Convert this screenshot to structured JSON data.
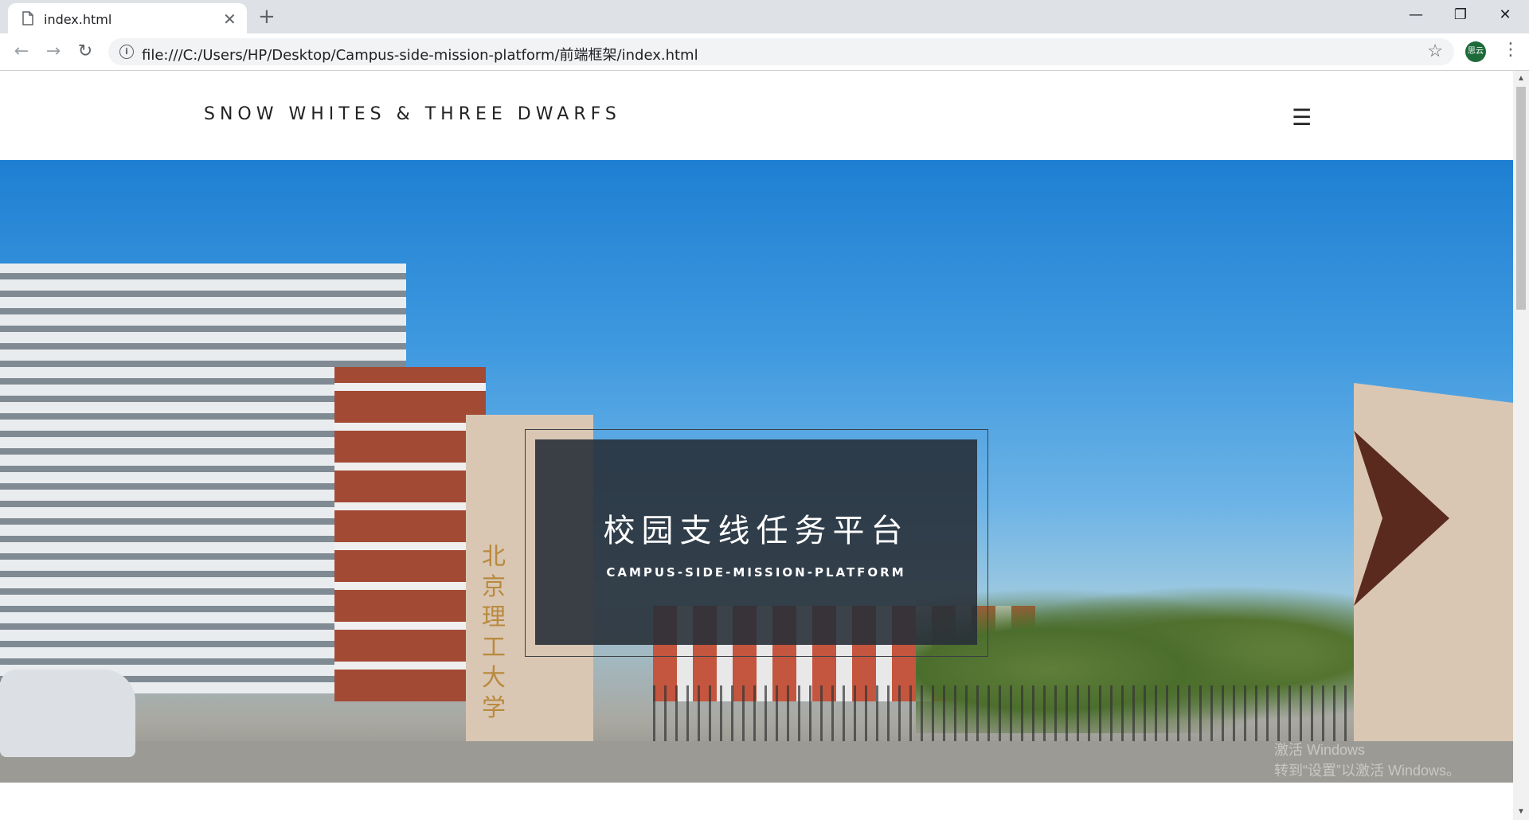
{
  "browser": {
    "tab_title": "index.html",
    "tab_close": "✕",
    "new_tab": "+",
    "window_controls": {
      "minimize": "—",
      "restore": "❐",
      "close": "✕"
    },
    "nav": {
      "back": "←",
      "forward": "→",
      "reload": "↻"
    },
    "url": "file:///C:/Users/HP/Desktop/Campus-side-mission-platform/前端框架/index.html",
    "info_icon": "i",
    "star": "☆",
    "profile_label": "思云",
    "menu": "⋮"
  },
  "site": {
    "brand": "SNOW WHITES & THREE DWARFS",
    "menu_icon": "☰"
  },
  "hero": {
    "title": "校园支线任务平台",
    "subtitle": "CAMPUS-SIDE-MISSION-PLATFORM",
    "gate_sign": "北京理工大学"
  },
  "watermark": {
    "line1": "激活 Windows",
    "line2": "转到“设置”以激活 Windows。"
  },
  "colors": {
    "tabbar": "#dee1e6",
    "overlay": "#283038",
    "profile": "#1e6b3a"
  }
}
